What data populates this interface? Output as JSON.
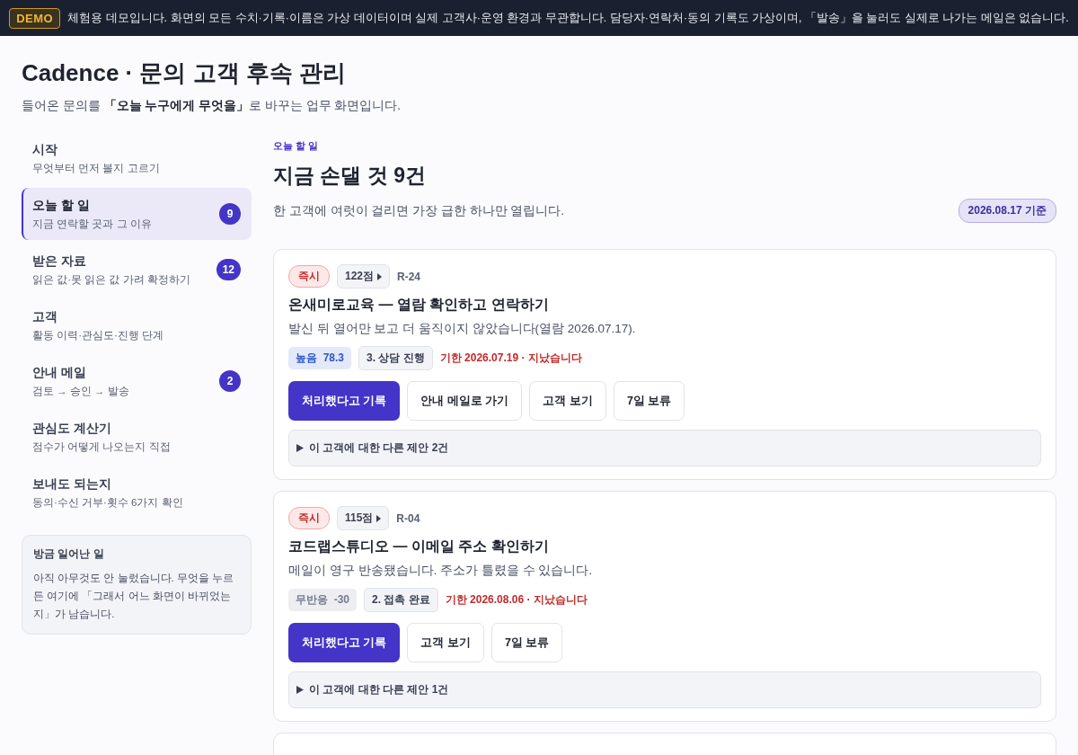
{
  "banner": {
    "badge": "DEMO",
    "text": "체험용 데모입니다. 화면의 모든 수치·기록·이름은 가상 데이터이며 실제 고객사·운영 환경과 무관합니다. 담당자·연락처·동의 기록도 가상이며, 「발송」을 눌러도 실제로 나가는 메일은 없습니다."
  },
  "header": {
    "title": "Cadence · 문의 고객 후속 관리",
    "subtitle": "들어온 문의를 **「오늘 누구에게 무엇을」**로 바꾸는 업무 화면입니다."
  },
  "sidebar": {
    "items": [
      {
        "label": "시작",
        "description": "무엇부터 먼저 볼지 고르기",
        "selected": false
      },
      {
        "label": "오늘 할 일",
        "description": "지금 연락할 곳과 그 이유",
        "selected": true,
        "count": "9"
      },
      {
        "label": "받은 자료",
        "description": "읽은 값·못 읽은 값 가려 확정하기",
        "selected": false,
        "count": "12"
      },
      {
        "label": "고객",
        "description": "활동 이력·관심도·진행 단계",
        "selected": false
      },
      {
        "label": "안내 메일",
        "description": "검토 → 승인 → 발송",
        "selected": false,
        "count": "2"
      },
      {
        "label": "관심도 계산기",
        "description": "점수가 어떻게 나오는지 직접",
        "selected": false
      },
      {
        "label": "보내도 되는지",
        "description": "동의·수신 거부·횟수 6가지 확인",
        "selected": false
      }
    ],
    "activity": {
      "title": "방금 일어난 일",
      "text": "아직 아무것도 안 눌렀습니다. 무엇을 누르든 여기에 「그래서 어느 화면이 바뀌었는지」가 남습니다."
    }
  },
  "main": {
    "eyebrow": "오늘 할 일",
    "title": "지금 손댈 것 9건",
    "subtitle": "한 고객에 여럿이 걸리면 가장 급한 하나만 열립니다.",
    "date_badge": "2026.08.17 기준",
    "cards": [
      {
        "urgency": "즉시",
        "score": "122점",
        "ref": "R-24",
        "title": "온새미로교육 — 열람 확인하고 연락하기",
        "reason": "발신 뒤 열어만 보고 더 움직이지 않았습니다(열람 2026.07.17).",
        "interest": {
          "kind": "high",
          "label": "높음",
          "value": "78.3"
        },
        "stage": "3. 상담 진행",
        "due": "기한 2026.07.19 · 지났습니다",
        "buttons": [
          {
            "label": "처리했다고 기록",
            "kind": "primary"
          },
          {
            "label": "안내 메일로 가기",
            "kind": "secondary"
          },
          {
            "label": "고객 보기",
            "kind": "secondary"
          },
          {
            "label": "7일 보류",
            "kind": "secondary"
          }
        ],
        "more": "이 고객에 대한 다른 제안 2건"
      },
      {
        "urgency": "즉시",
        "score": "115점",
        "ref": "R-04",
        "title": "코드랩스튜디오 — 이메일 주소 확인하기",
        "reason": "메일이 영구 반송됐습니다. 주소가 틀렸을 수 있습니다.",
        "interest": {
          "kind": "none",
          "label": "무반응",
          "value": "-30"
        },
        "stage": "2. 접촉 완료",
        "due": "기한 2026.08.06 · 지났습니다",
        "buttons": [
          {
            "label": "처리했다고 기록",
            "kind": "primary"
          },
          {
            "label": "고객 보기",
            "kind": "secondary"
          },
          {
            "label": "7일 보류",
            "kind": "secondary"
          }
        ],
        "more": "이 고객에 대한 다른 제안 1건"
      }
    ]
  }
}
